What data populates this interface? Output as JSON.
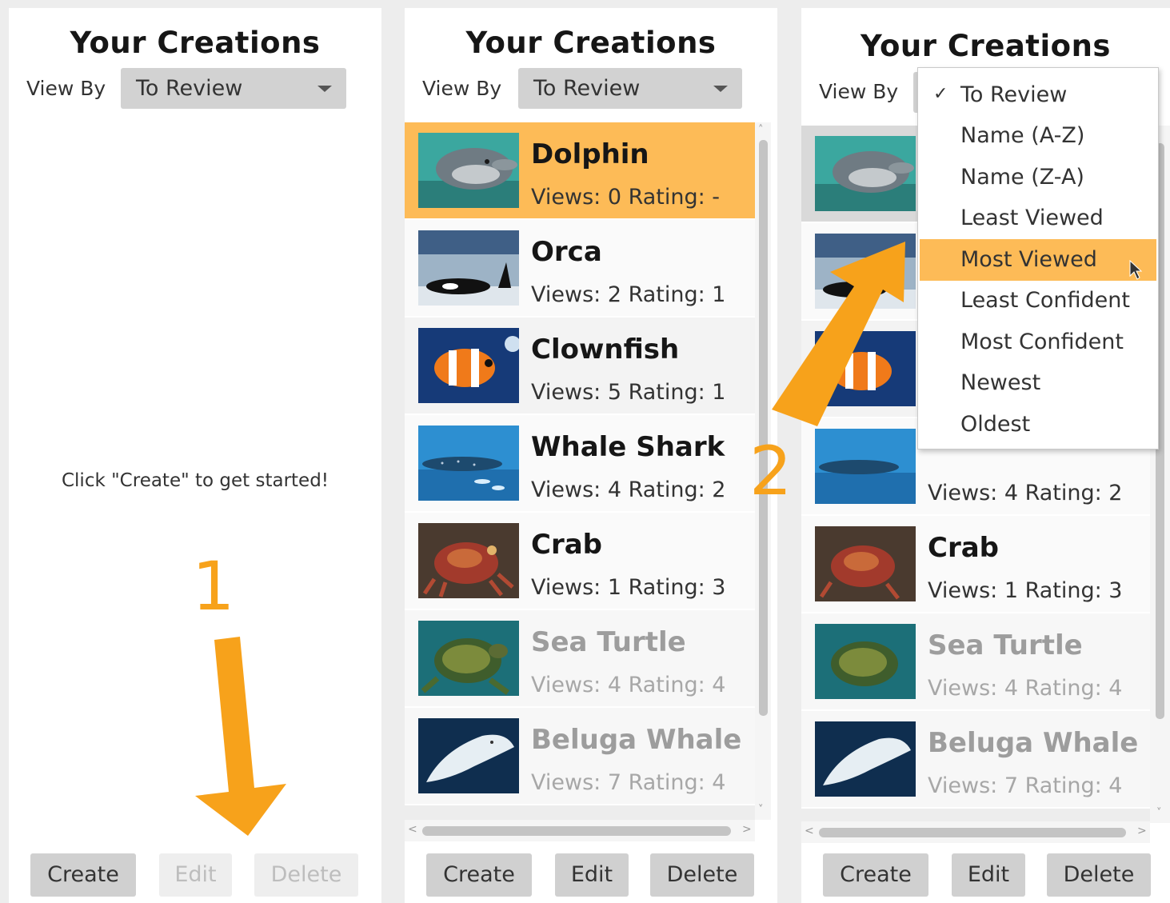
{
  "panels": [
    {
      "title": "Your Creations",
      "view_by_label": "View By",
      "dropdown_value": "To Review",
      "empty_message": "Click \"Create\" to get started!",
      "buttons": {
        "create": "Create",
        "edit": "Edit",
        "delete": "Delete"
      }
    },
    {
      "title": "Your Creations",
      "view_by_label": "View By",
      "dropdown_value": "To Review",
      "buttons": {
        "create": "Create",
        "edit": "Edit",
        "delete": "Delete"
      },
      "items": [
        {
          "name": "Dolphin",
          "stats": "Views: 0 Rating: -"
        },
        {
          "name": "Orca",
          "stats": "Views: 2 Rating: 1"
        },
        {
          "name": "Clownfish",
          "stats": "Views: 5 Rating: 1"
        },
        {
          "name": "Whale Shark",
          "stats": "Views: 4 Rating: 2"
        },
        {
          "name": "Crab",
          "stats": "Views: 1 Rating: 3"
        },
        {
          "name": "Sea Turtle",
          "stats": "Views: 4 Rating: 4"
        },
        {
          "name": "Beluga Whale",
          "stats": "Views: 7 Rating: 4"
        }
      ]
    },
    {
      "title": "Your Creations",
      "view_by_label": "View By",
      "buttons": {
        "create": "Create",
        "edit": "Edit",
        "delete": "Delete"
      },
      "items": [
        {
          "name": "",
          "stats": ""
        },
        {
          "name": "",
          "stats": ""
        },
        {
          "name": "",
          "stats": ""
        },
        {
          "name": "",
          "stats": "Views: 4 Rating: 2"
        },
        {
          "name": "Crab",
          "stats": "Views: 1 Rating: 3"
        },
        {
          "name": "Sea Turtle",
          "stats": "Views: 4 Rating: 4"
        },
        {
          "name": "Beluga Whale",
          "stats": "Views: 7 Rating: 4"
        }
      ],
      "menu": {
        "checked": "To Review",
        "hovered": "Most Viewed",
        "options": [
          "To Review",
          "Name (A-Z)",
          "Name (Z-A)",
          "Least Viewed",
          "Most Viewed",
          "Least Confident",
          "Most Confident",
          "Newest",
          "Oldest"
        ]
      }
    }
  ],
  "annotations": {
    "step1": "1",
    "step2": "2"
  },
  "colors": {
    "highlight": "#fdbb57",
    "annotation": "#f7a21b"
  }
}
